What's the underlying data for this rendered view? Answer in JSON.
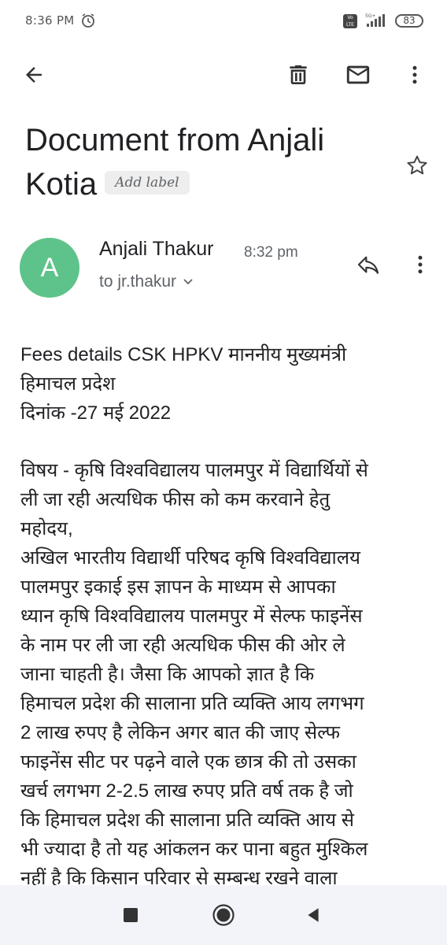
{
  "status_bar": {
    "time": "8:36 PM",
    "volte": "Vo LTE",
    "network": "5G+",
    "battery": "83",
    "icons": [
      "alarm-icon",
      "volte-icon",
      "signal-icon",
      "battery-icon"
    ]
  },
  "toolbar": {
    "icons": [
      "back-arrow-icon",
      "trash-icon",
      "mail-icon",
      "more-vertical-icon"
    ]
  },
  "email": {
    "subject": "Document from Anjali Kotia",
    "label_chip": "Add label",
    "sender_name": "Anjali Thakur",
    "sender_initial": "A",
    "time": "8:32 pm",
    "recipient": "to jr.thakur",
    "avatar_color": "#5ec38a",
    "body": [
      "Fees details CSK HPKV माननीय मुख्यमंत्री",
      "हिमाचल प्रदेश",
      "दिनांक -27 मई 2022",
      "",
      "विषय - कृषि विश्वविद्यालय पालमपुर में विद्यार्थियों से",
      "ली जा रही अत्यधिक फीस को कम करवाने हेतु",
      "महोदय,",
      "अखिल भारतीय विद्यार्थी परिषद कृषि विश्वविद्यालय",
      "पालमपुर इकाई इस ज्ञापन के माध्यम से आपका",
      "ध्यान कृषि विश्वविद्यालय पालमपुर में सेल्फ फाइनेंस",
      "के नाम पर ली जा रही अत्यधिक फीस की ओर ले",
      "जाना चाहती है। जैसा कि आपको ज्ञात है कि",
      "हिमाचल प्रदेश की सालाना प्रति व्यक्ति आय लगभग",
      "2 लाख रुपए है लेकिन अगर बात की जाए सेल्फ",
      "फाइनेंस सीट पर पढ़ने वाले एक छात्र की तो उसका",
      "खर्च लगभग 2-2.5 लाख रुपए प्रति वर्ष तक है जो",
      "कि हिमाचल प्रदेश की सालाना प्रति व्यक्ति आय से",
      "भी ज्यादा है तो यह आंकलन कर पाना बहुत मुश्किल",
      "नहीं है कि किसान परिवार से सम्बन्ध रखने वाला"
    ]
  },
  "nav_bar": {
    "icons": [
      "recents-square-icon",
      "home-circle-icon",
      "back-triangle-icon"
    ]
  },
  "colors": {
    "accent_green": "#5ec38a",
    "nav_background": "#f3f4fa",
    "text_primary": "#202124",
    "text_secondary": "#5f6368"
  }
}
